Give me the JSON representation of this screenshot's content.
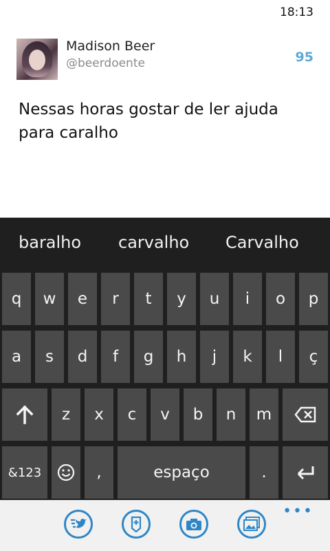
{
  "status": {
    "time": "18:13"
  },
  "tweet": {
    "name": "Madison Beer",
    "handle": "@beerdoente",
    "char_count": "95",
    "text": "Nessas horas gostar de ler ajuda para caralho"
  },
  "keyboard": {
    "suggestions": [
      "baralho",
      "carvalho",
      "Carvalho"
    ],
    "row1": [
      "q",
      "w",
      "e",
      "r",
      "t",
      "y",
      "u",
      "i",
      "o",
      "p"
    ],
    "row2": [
      "a",
      "s",
      "d",
      "f",
      "g",
      "h",
      "j",
      "k",
      "l",
      "ç"
    ],
    "row3": [
      "z",
      "x",
      "c",
      "v",
      "b",
      "n",
      "m"
    ],
    "symbols": "&123",
    "comma": ",",
    "space": "espaço",
    "period": "."
  },
  "icons": {
    "shift": "arrow-up-icon",
    "backspace": "backspace-icon",
    "emoji": "smiley-icon",
    "enter": "enter-icon",
    "bird": "twitter-bird-icon",
    "pin": "location-pin-icon",
    "camera": "camera-icon",
    "gallery": "image-gallery-icon"
  },
  "colors": {
    "accent": "#2f86c6",
    "count": "#5da9d6",
    "keyboard_bg": "#1f1f1f",
    "key_bg": "#4a4a4a"
  }
}
